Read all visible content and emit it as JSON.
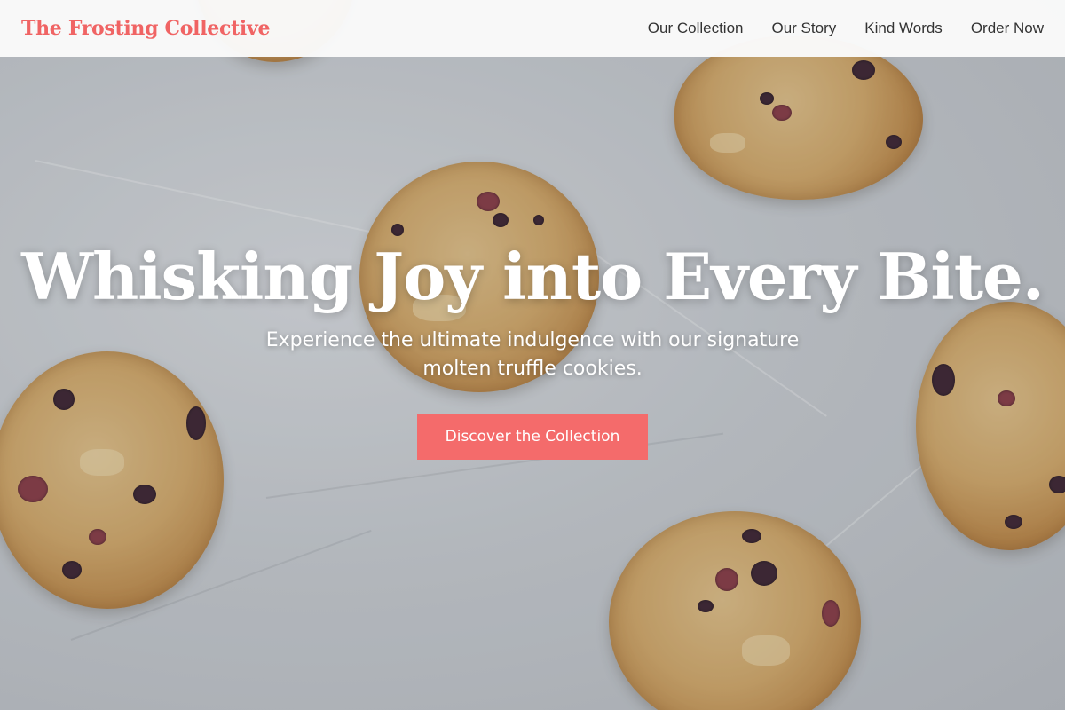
{
  "brand": {
    "name": "The Frosting Collective",
    "color": "#f06464"
  },
  "nav": {
    "links": [
      "Our Collection",
      "Our Story",
      "Kind Words",
      "Order Now"
    ]
  },
  "hero": {
    "headline": "Whisking Joy into Every Bite.",
    "subheadline": "Experience the ultimate indulgence with our signature molten truffle cookies.",
    "cta_label": "Discover the Collection",
    "cta_color": "#f46b6b",
    "background": "cookies-on-parchment-photo"
  }
}
